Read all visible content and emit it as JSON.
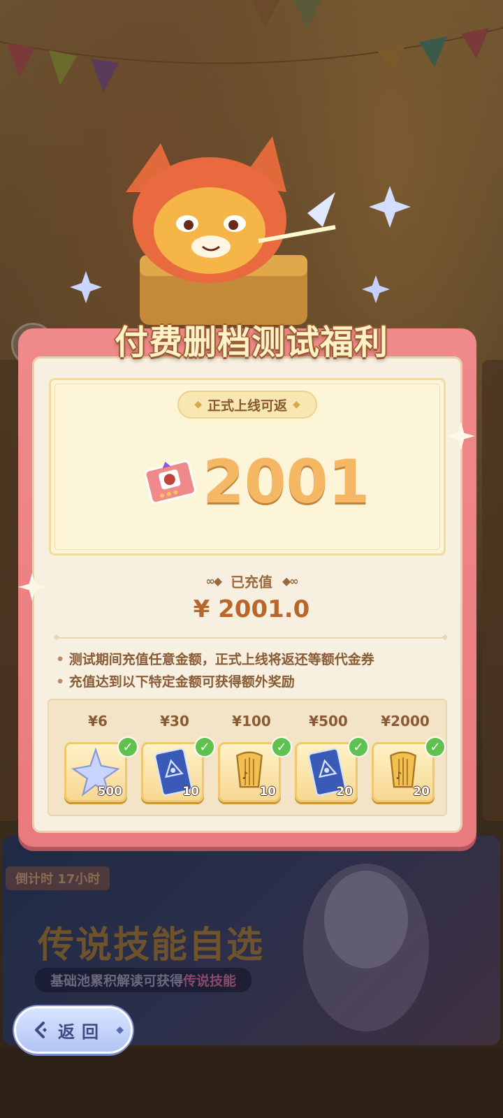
{
  "colors": {
    "panel_pink": "#e97a7e",
    "panel_cream": "#f7efdf",
    "gold_text": "#f4b865",
    "brown_text": "#8a5a34",
    "check_green": "#5fc24e",
    "back_blue": "#b2c4f4"
  },
  "popup": {
    "title": "付费删档测试福利",
    "refund_tag": "正式上线可返",
    "refund_amount": "2001",
    "recharged_label": "已充值",
    "recharged_amount": "¥ 2001.0",
    "notes": [
      "测试期间充值任意金额，正式上线将返还等额代金券",
      "充值达到以下特定金额可获得额外奖励"
    ],
    "rewards": [
      {
        "price": "¥6",
        "qty": "500",
        "icon": "star-crystal-icon",
        "claimed": true
      },
      {
        "price": "¥30",
        "qty": "10",
        "icon": "tarot-card-icon",
        "claimed": true
      },
      {
        "price": "¥100",
        "qty": "10",
        "icon": "golden-lyre-icon",
        "claimed": true
      },
      {
        "price": "¥500",
        "qty": "20",
        "icon": "tarot-card-icon",
        "claimed": true
      },
      {
        "price": "¥2000",
        "qty": "20",
        "icon": "golden-lyre-icon",
        "claimed": true
      }
    ]
  },
  "background": {
    "countdown": "倒计时 17小时",
    "banner_title": "传说技能自选",
    "banner_sub_prefix": "基础池累积解读可获得",
    "banner_sub_highlight": "传说技能"
  },
  "back_button": {
    "label": "返回"
  }
}
